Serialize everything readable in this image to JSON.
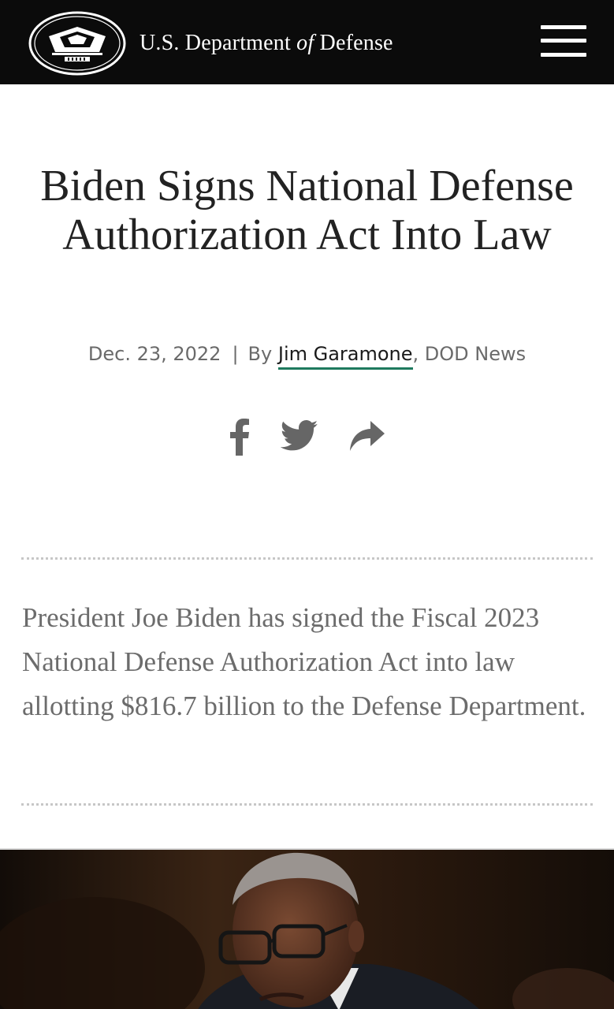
{
  "header": {
    "site_name_prefix": "U.S. Department ",
    "site_name_of": "of",
    "site_name_suffix": " Defense",
    "background": "#0b0b0b"
  },
  "article": {
    "title": "Biden Signs National Defense Authorization Act Into Law",
    "date": "Dec. 23, 2022",
    "separator": "|",
    "by_label": "By",
    "author": "Jim Garamone",
    "source": ", DOD News",
    "summary": "President Joe Biden has signed the Fiscal 2023 National Defense Authorization Act into law allotting $816.7 billion to the Defense Department."
  },
  "share": {
    "icons": [
      "facebook-icon",
      "twitter-icon",
      "share-arrow-icon"
    ],
    "icon_color": "#666666"
  },
  "colors": {
    "author_underline": "#1e7a5e",
    "headline": "#222222",
    "summary": "#6c6c6c"
  }
}
